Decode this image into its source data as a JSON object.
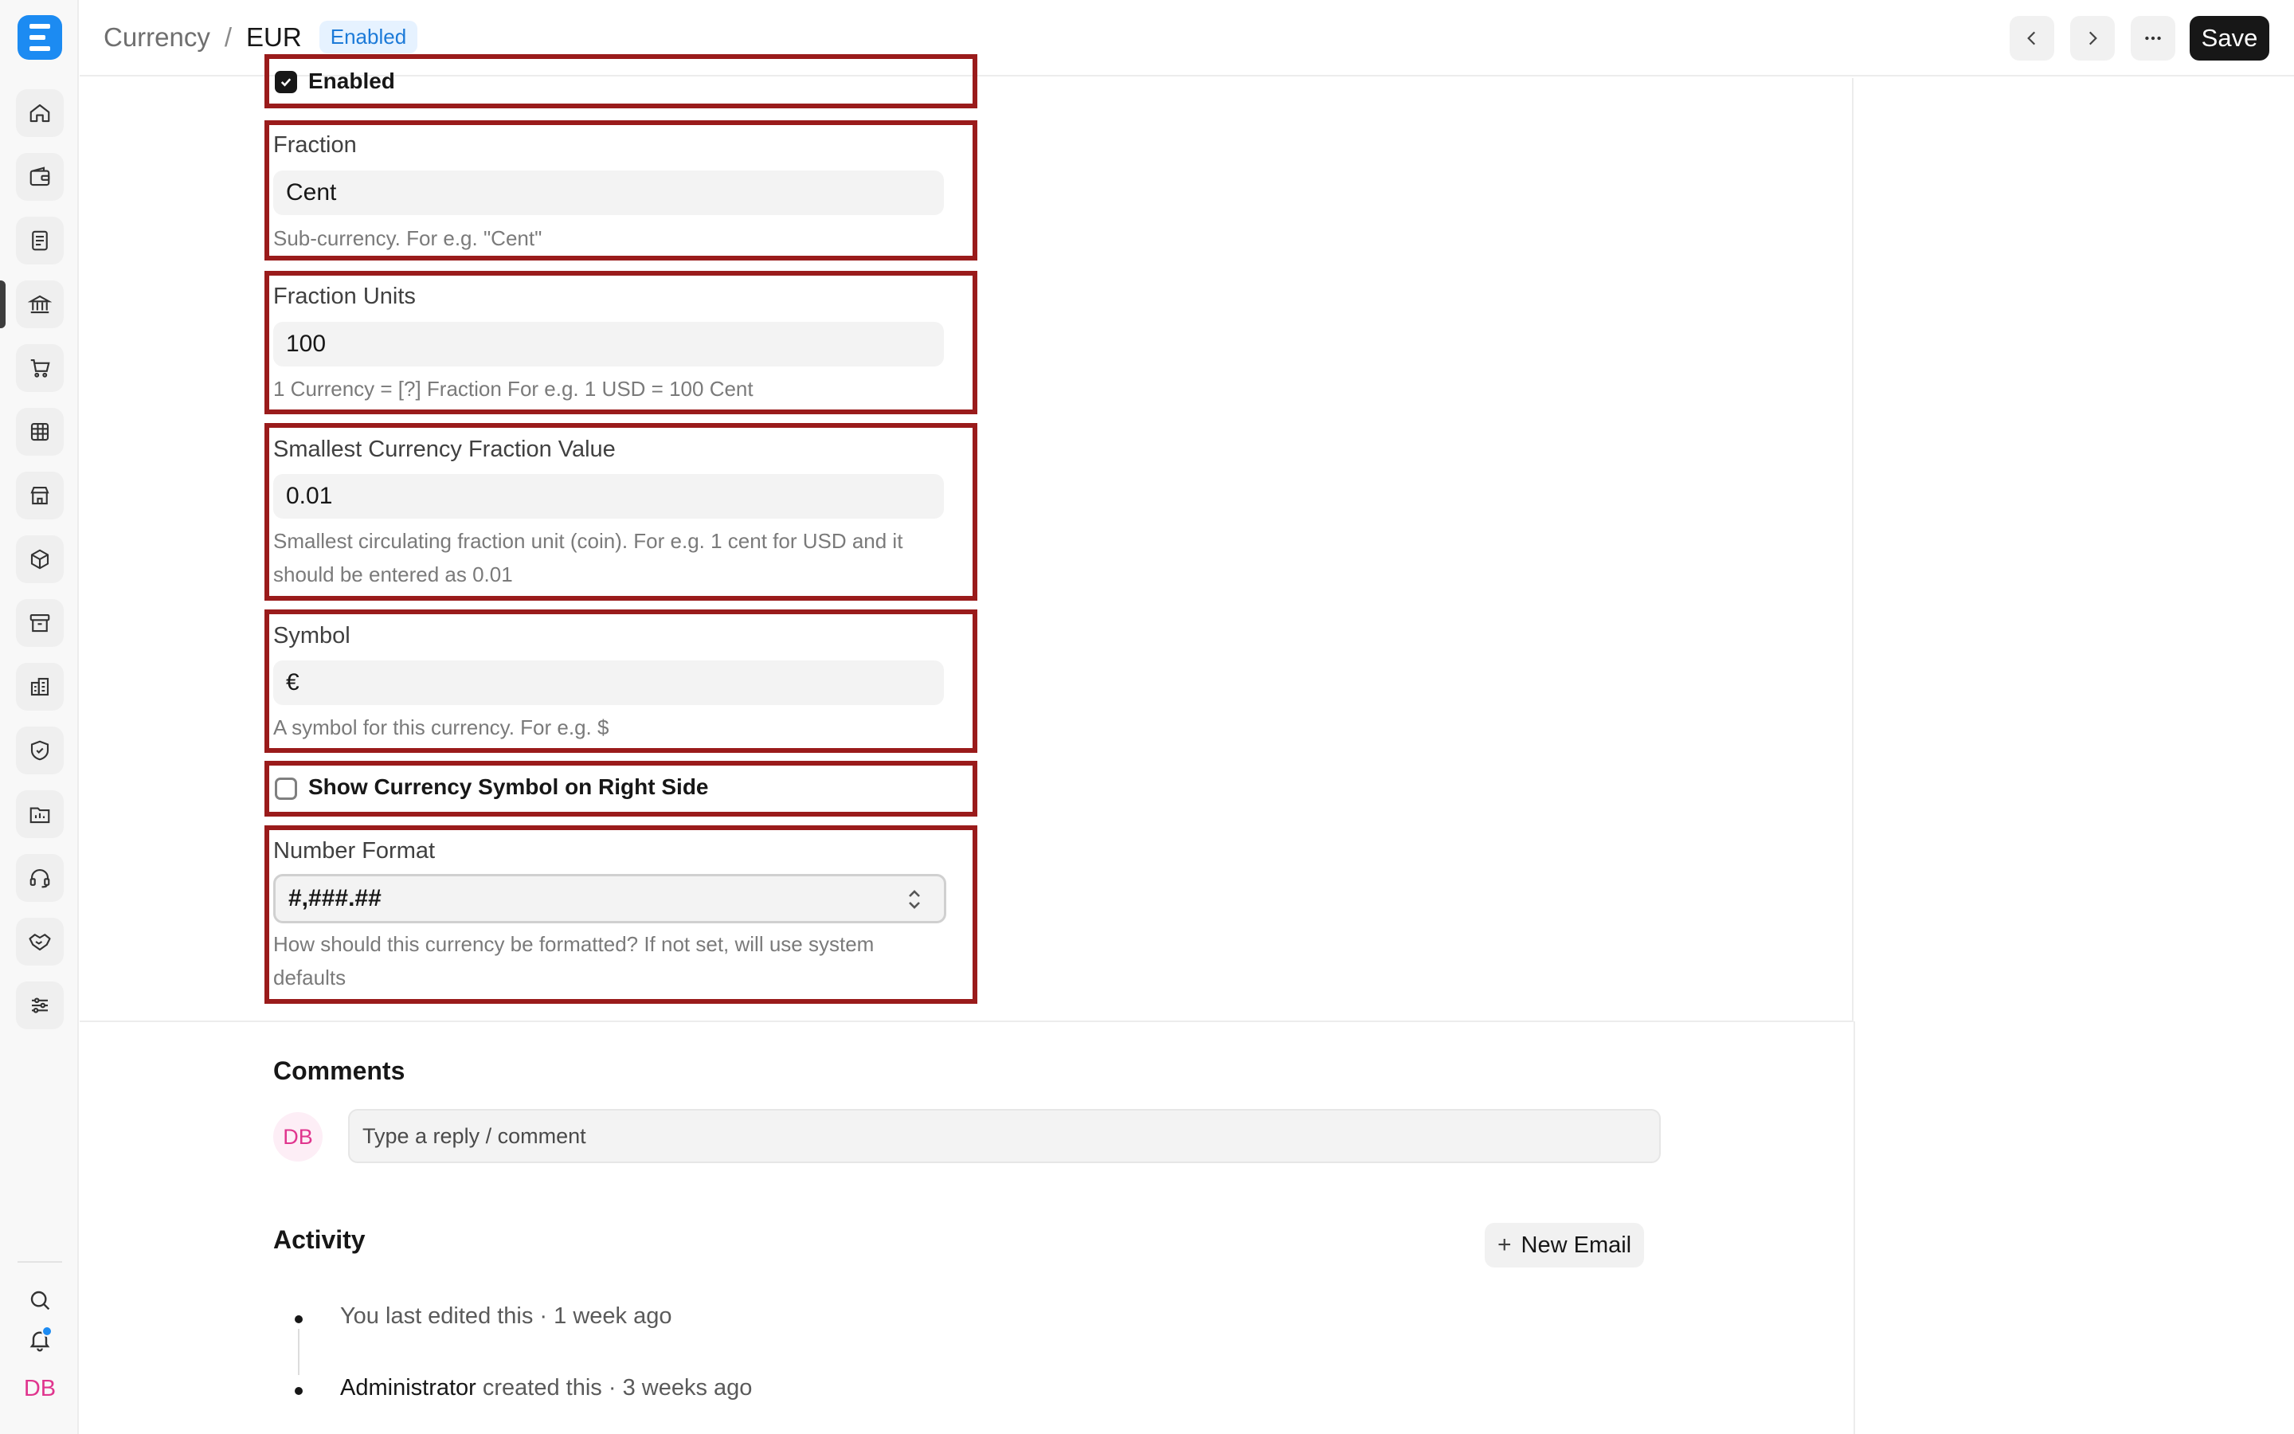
{
  "app": {
    "logo_letter": "E",
    "accent_color": "#1c8bf2",
    "highlight_color": "#9a1b1b"
  },
  "sidebar": {
    "items": [
      {
        "name": "home-icon"
      },
      {
        "name": "wallet-icon"
      },
      {
        "name": "document-icon"
      },
      {
        "name": "bank-icon",
        "active": true
      },
      {
        "name": "cart-icon"
      },
      {
        "name": "table-icon"
      },
      {
        "name": "store-icon"
      },
      {
        "name": "box-icon"
      },
      {
        "name": "archive-icon"
      },
      {
        "name": "building-icon"
      },
      {
        "name": "shield-icon"
      },
      {
        "name": "folder-chart-icon"
      },
      {
        "name": "headset-icon"
      },
      {
        "name": "handshake-icon"
      },
      {
        "name": "sliders-icon"
      }
    ],
    "bottom": {
      "search_icon": "search-icon",
      "bell_icon": "bell-icon",
      "user_initials": "DB"
    }
  },
  "header": {
    "breadcrumb_parent": "Currency",
    "breadcrumb_separator": "/",
    "breadcrumb_current": "EUR",
    "status_badge": "Enabled",
    "save_label": "Save"
  },
  "form": {
    "enabled": {
      "label": "Enabled",
      "checked": true
    },
    "fraction": {
      "label": "Fraction",
      "value": "Cent",
      "description": "Sub-currency. For e.g. \"Cent\""
    },
    "fraction_units": {
      "label": "Fraction Units",
      "value": "100",
      "description": "1 Currency = [?] Fraction For e.g. 1 USD = 100 Cent"
    },
    "smallest_fraction": {
      "label": "Smallest Currency Fraction Value",
      "value": "0.01",
      "description_line1": "Smallest circulating fraction unit (coin). For e.g. 1 cent for USD and it",
      "description_line2": "should be entered as 0.01"
    },
    "symbol": {
      "label": "Symbol",
      "value": "€",
      "description": "A symbol for this currency. For e.g. $"
    },
    "symbol_on_right": {
      "label": "Show Currency Symbol on Right Side",
      "checked": false
    },
    "number_format": {
      "label": "Number Format",
      "value": "#,###.##",
      "description_line1": "How should this currency be formatted? If not set, will use system",
      "description_line2": "defaults"
    }
  },
  "comments": {
    "title": "Comments",
    "avatar_initials": "DB",
    "placeholder": "Type a reply / comment"
  },
  "activity": {
    "title": "Activity",
    "new_email_label": "New Email",
    "items": [
      {
        "who": "",
        "text": "You last edited this · 1 week ago"
      },
      {
        "who": "Administrator",
        "text": " created this · 3 weeks ago"
      }
    ]
  }
}
